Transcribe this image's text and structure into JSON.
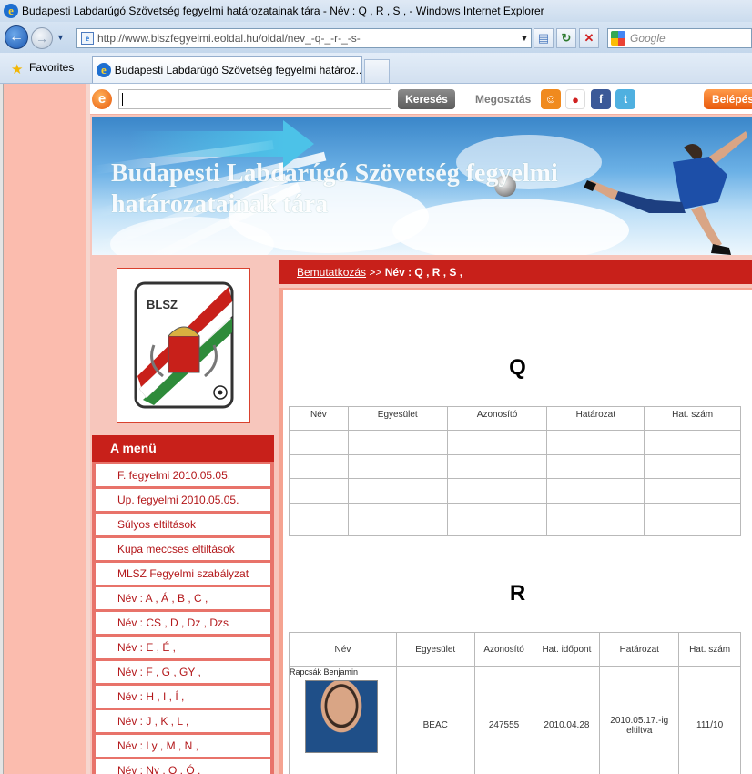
{
  "window": {
    "title": "Budapesti Labdarúgó Szövetség fegyelmi határozatainak tára - Név : Q , R , S , - Windows Internet Explorer"
  },
  "address": {
    "url": "http://www.blszfegyelmi.eoldal.hu/oldal/nev_-q-_-r-_-s-",
    "search_placeholder": "Google"
  },
  "tabs": {
    "favorites_label": "Favorites",
    "active_tab_label": "Budapesti Labdarúgó Szövetség fegyelmi határoz..."
  },
  "eoldal": {
    "logo": "e",
    "search_button": "Keresés",
    "share_label": "Megosztás",
    "login_label": "Belépés"
  },
  "site": {
    "title": "Budapesti Labdarúgó Szövetség fegyelmi határozatainak tára",
    "logo_text": "BLSZ"
  },
  "menu": {
    "header": "A menü",
    "items": [
      "F. fegyelmi 2010.05.05.",
      "Up. fegyelmi 2010.05.05.",
      "Súlyos eltiltások",
      "Kupa meccses eltiltások",
      "MLSZ Fegyelmi szabályzat",
      "Név : A , Á , B , C ,",
      "Név : CS , D , Dz , Dzs",
      "Név : E , É ,",
      "Név : F , G , GY ,",
      "Név : H , I , Í ,",
      "Név : J , K , L ,",
      "Név : Ly , M , N ,",
      "Név : Ny , O , Ó ,"
    ]
  },
  "breadcrumb": {
    "link": "Bemutatkozás",
    "separator": ">>",
    "current": "Név : Q , R , S ,"
  },
  "section_q": {
    "letter": "Q",
    "headers": [
      "Név",
      "Egyesület",
      "Azonosító",
      "Határozat",
      "Hat. szám"
    ]
  },
  "section_r": {
    "letter": "R",
    "headers": [
      "Név",
      "Egyesület",
      "Azonosító",
      "Hat. időpont",
      "Határozat",
      "Hat. szám"
    ],
    "rows": [
      {
        "name": "Rapcsák Benjamin",
        "club": "BEAC",
        "id": "247555",
        "date": "2010.04.28",
        "decision": "2010.05.17.-ig eltiltva",
        "number": "111/10"
      }
    ]
  },
  "colors": {
    "brand_red": "#c8201a",
    "page_bg": "#fbbcae",
    "menu_link": "#b3171a"
  },
  "icons": {
    "back": "back-arrow-icon",
    "forward": "forward-arrow-icon",
    "favorites": "star-icon",
    "share": [
      "share-icon",
      "iwiw-icon",
      "facebook-icon",
      "twitter-icon"
    ]
  }
}
